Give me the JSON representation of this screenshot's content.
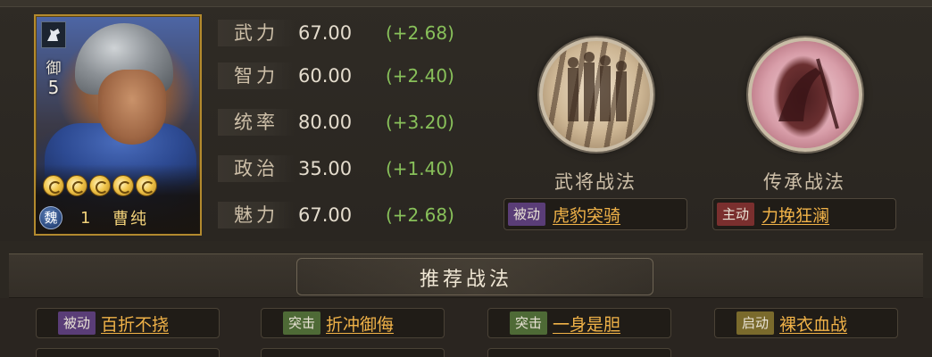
{
  "hero": {
    "type_icon": "horse-icon",
    "troop_label": "御",
    "troop_number": "5",
    "stars": 5,
    "faction": "魏",
    "level": "1",
    "name": "曹纯"
  },
  "attributes": [
    {
      "label": "武力",
      "value": "67.00",
      "bonus": "(+2.68)"
    },
    {
      "label": "智力",
      "value": "60.00",
      "bonus": "(+2.40)"
    },
    {
      "label": "统率",
      "value": "80.00",
      "bonus": "(+3.20)"
    },
    {
      "label": "政治",
      "value": "35.00",
      "bonus": "(+1.40)"
    },
    {
      "label": "魅力",
      "value": "67.00",
      "bonus": "(+2.68)"
    }
  ],
  "tactics": {
    "warrior": {
      "title": "武将战法",
      "type": "被动",
      "name": "虎豹突骑"
    },
    "inherit": {
      "title": "传承战法",
      "type": "主动",
      "name": "力挽狂澜"
    }
  },
  "recommended": {
    "title": "推荐战法",
    "items": [
      {
        "type": "被动",
        "name": "百折不挠"
      },
      {
        "type": "突击",
        "name": "折冲御侮"
      },
      {
        "type": "突击",
        "name": "一身是胆"
      },
      {
        "type": "启动",
        "name": "裸衣血战"
      }
    ]
  },
  "colors": {
    "bonus_green": "#88c05a",
    "tactic_name_gold": "#f0b248",
    "frame_gold": "#b38a2e"
  }
}
